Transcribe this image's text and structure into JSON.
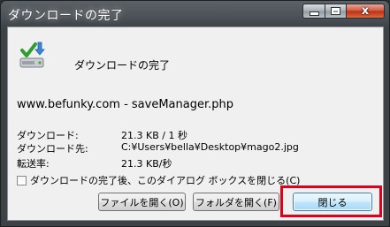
{
  "window": {
    "title": "ダウンロードの完了"
  },
  "titlebar_buttons": {
    "close_glyph": "x"
  },
  "dialog": {
    "heading": "ダウンロードの完了",
    "source": "www.befunky.com - saveManager.php",
    "details": [
      {
        "label": "ダウンロード:",
        "value": "21.3 KB / 1 秒"
      },
      {
        "label": "ダウンロード先:",
        "value": "C:¥Users¥bella¥Desktop¥mago2.jpg"
      },
      {
        "label": "転送率:",
        "value": "21.3 KB/秒"
      }
    ],
    "close_when_complete": {
      "checked": false,
      "label": "ダウンロードの完了後、このダイアログ ボックスを閉じる(C)"
    },
    "buttons": {
      "open_file": "ファイルを開く(O)",
      "open_folder": "フォルダを開く(F)",
      "close": "閉じる"
    }
  },
  "colors": {
    "highlight": "#e0001a",
    "titlebar": "#4a5055"
  },
  "icons": {
    "download_complete": "download-complete-icon"
  }
}
